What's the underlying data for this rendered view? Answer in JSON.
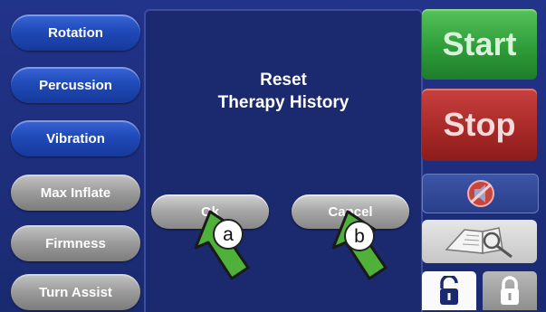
{
  "left_menu": {
    "rotation": "Rotation",
    "percussion": "Percussion",
    "vibration": "Vibration",
    "max_inflate": "Max Inflate",
    "firmness": "Firmness",
    "turn_assist": "Turn Assist"
  },
  "dialog": {
    "title_line1": "Reset",
    "title_line2": "Therapy History",
    "ok_label": "Ok",
    "cancel_label": "Cancel"
  },
  "callouts": {
    "a": "a",
    "b": "b"
  },
  "right_panel": {
    "start_label": "Start",
    "stop_label": "Stop"
  },
  "icons": {
    "alarm_silence": "alarm-silence-icon",
    "manual": "manual-search-icon",
    "unlock": "unlocked-padlock-icon",
    "lock": "locked-padlock-icon"
  },
  "colors": {
    "background": "#1a2b6e",
    "menu_blue": "#1f4ab8",
    "menu_gray": "#9a9a9a",
    "start_green": "#2e9d3a",
    "stop_red": "#a92a28",
    "arrow_green": "#4fb03a"
  }
}
